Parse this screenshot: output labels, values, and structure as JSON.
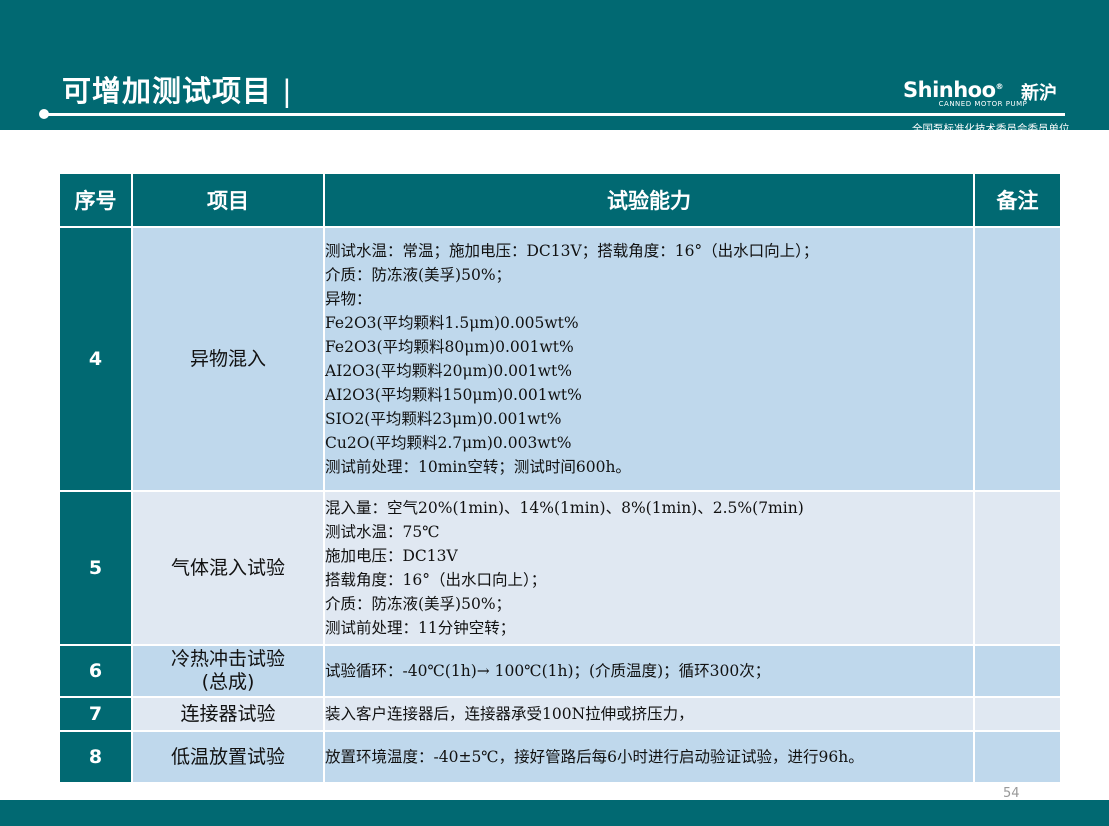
{
  "header": {
    "title": "可增加测试项目",
    "title_bar": "|",
    "logo_text": "Shinhoo",
    "logo_mark": "®",
    "logo_cn": "新沪",
    "logo_sub": "CANNED MOTOR PUMP",
    "committee": "全国泵标准化技术委员会委员单位"
  },
  "table": {
    "headers": [
      "序号",
      "项目",
      "试验能力",
      "备注"
    ],
    "rows": [
      {
        "num": "4",
        "item": "异物混入",
        "lines": [
          "测试水温：常温；施加电压：DC13V；搭载角度：16°（出水口向上）；",
          "介质：防冻液(美孚)50%；",
          "异物：",
          "Fe2O3(平均颗料1.5μm)0.005wt%",
          "Fe2O3(平均颗料80μm)0.001wt%",
          "AI2O3(平均颗料20μm)0.001wt%",
          "AI2O3(平均颗料150μm)0.001wt%",
          "SIO2(平均颗料23μm)0.001wt%",
          "Cu2O(平均颗料2.7μm)0.003wt%",
          "测试前处理：10min空转；测试时间600h。"
        ],
        "note": ""
      },
      {
        "num": "5",
        "item": "气体混入试验",
        "lines": [
          "混入量：空气20%(1min)、14%(1min)、8%(1min)、2.5%(7min)",
          "测试水温：75℃",
          "施加电压：DC13V",
          "搭载角度：16°（出水口向上）；",
          "介质：防冻液(美孚)50%；",
          "测试前处理：11分钟空转；"
        ],
        "note": ""
      },
      {
        "num": "6",
        "item_lines": [
          "冷热冲击试验",
          "(总成)"
        ],
        "lines": [
          "试验循环：-40℃(1h)→ 100℃(1h)；(介质温度)；循环300次；"
        ],
        "note": ""
      },
      {
        "num": "7",
        "item": "连接器试验",
        "lines": [
          "装入客户连接器后，连接器承受100N拉伸或挤压力，"
        ],
        "note": ""
      },
      {
        "num": "8",
        "item": "低温放置试验",
        "lines": [
          "放置环境温度：-40±5℃，接好管路后每6小时进行启动验证试验，进行96h。"
        ],
        "note": ""
      }
    ]
  },
  "footer": {
    "page_number": "54"
  }
}
